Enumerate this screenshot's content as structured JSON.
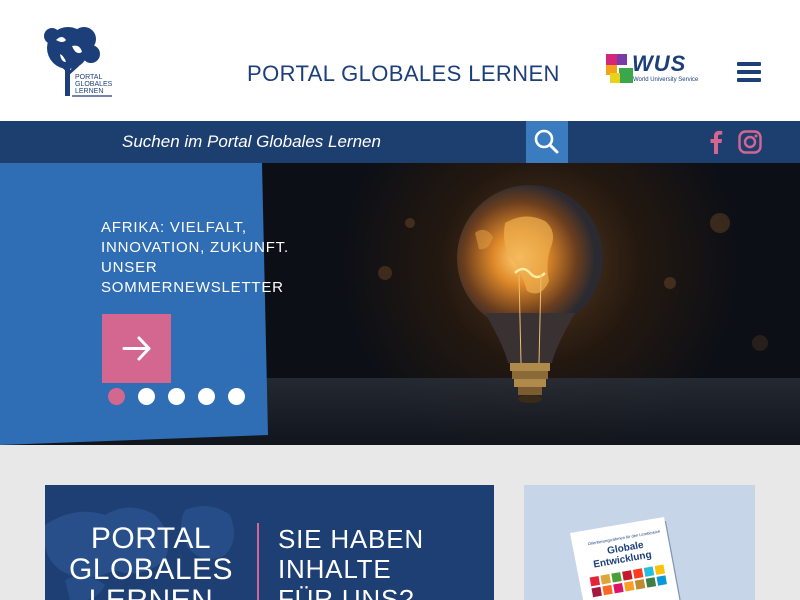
{
  "header": {
    "logo_text": [
      "PORTAL",
      "GLOBALES",
      "LERNEN"
    ],
    "site_title": "PORTAL GLOBALES LERNEN",
    "partner_logo": {
      "name": "WUS",
      "subtitle": "World University Service"
    },
    "menu_icon": "hamburger-icon"
  },
  "search": {
    "placeholder": "Suchen im Portal Globales Lernen",
    "button_icon": "search-icon"
  },
  "social": [
    {
      "name": "facebook-icon"
    },
    {
      "name": "instagram-icon"
    }
  ],
  "hero": {
    "headline": "Afrika: Vielfalt, Innovation, Zukunft. Unser Sommernewsletter",
    "arrow_icon": "arrow-right-icon",
    "slides_count": 5,
    "active_slide": 1
  },
  "promo": {
    "left_lines": [
      "PORTAL",
      "GLOBALES",
      "LERNEN"
    ],
    "right_lines": [
      "SIE HABEN",
      "INHALTE",
      "FÜR UNS?"
    ]
  },
  "book": {
    "small_text": "Orientierungsrahmen für den Lernbereich",
    "title_lines": [
      "Globale",
      "Entwicklung"
    ]
  },
  "colors": {
    "brand_blue": "#1d3f79",
    "search_bar": "#1d3f70",
    "accent_blue": "#3b7bc0",
    "pink": "#d4678f",
    "gray_bg": "#e8e8e8"
  }
}
